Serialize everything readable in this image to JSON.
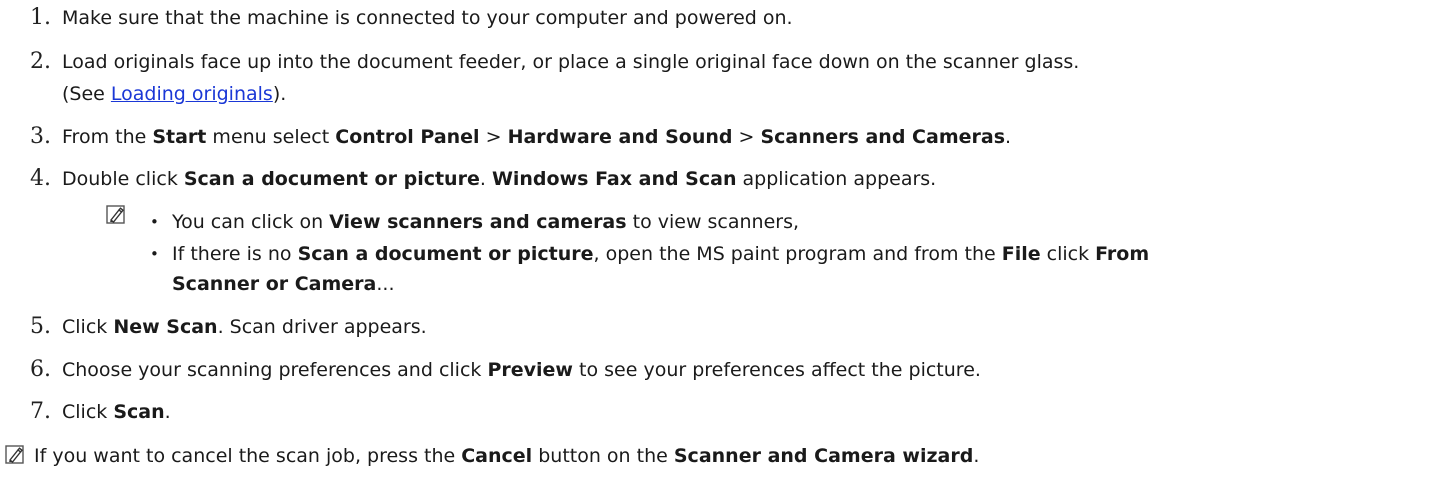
{
  "steps": [
    {
      "num": "1.",
      "parts": [
        "Make sure that the machine is connected to your computer and powered on."
      ]
    },
    {
      "num": "2.",
      "line1": "Load originals face up into the document feeder, or place a single original face down on the scanner glass.",
      "line2_prefix": "(See ",
      "link": "Loading originals",
      "line2_suffix": ")."
    },
    {
      "num": "3.",
      "t1": "From the ",
      "b1": "Start",
      "t2": " menu select ",
      "b2": "Control Panel",
      "t3": " > ",
      "b3": "Hardware and Sound",
      "t4": " > ",
      "b4": "Scanners and Cameras",
      "t5": "."
    },
    {
      "num": "4.",
      "t1": "Double click ",
      "b1": "Scan a document or picture",
      "t2": ". ",
      "b2": "Windows Fax and Scan",
      "t3": " application appears."
    },
    {
      "num": "5.",
      "t1": "Click ",
      "b1": "New Scan",
      "t2": ". Scan driver appears."
    },
    {
      "num": "6.",
      "t1": "Choose your scanning preferences and click ",
      "b1": "Preview",
      "t2": " to see your preferences affect the picture."
    },
    {
      "num": "7.",
      "t1": "Click ",
      "b1": "Scan",
      "t2": "."
    }
  ],
  "note_bullets": {
    "bullet": "•",
    "b1_t1": "You can click on ",
    "b1_b1": "View scanners and cameras",
    "b1_t2": " to view scanners,",
    "b2_t1": "If there is no ",
    "b2_b1": "Scan a document or picture",
    "b2_t2": ", open the MS paint program and from the ",
    "b2_b2": "File",
    "b2_t3": " click ",
    "b2_b3": "From",
    "b2_b4": "Scanner or Camera",
    "b2_t4": "..."
  },
  "footer_note": {
    "t1": "If you want to cancel the scan job, press the ",
    "b1": "Cancel",
    "t2": " button on the ",
    "b2": "Scanner and Camera wizard",
    "t3": "."
  },
  "icons": {
    "note": "note-pencil-icon"
  }
}
